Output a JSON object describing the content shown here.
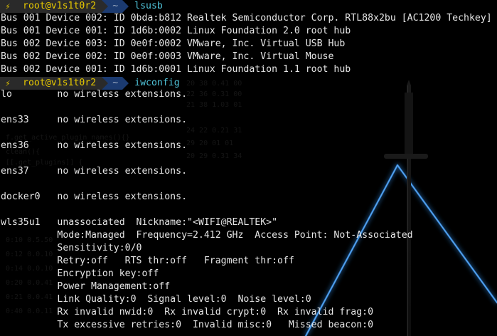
{
  "prompt": {
    "bolt_icon": "lightning-icon",
    "user_host": "root@v1s1t0r2",
    "directory": "~"
  },
  "lsusb": {
    "command": "lsusb",
    "lines": [
      "Bus 001 Device 002: ID 0bda:b812 Realtek Semiconductor Corp. RTL88x2bu [AC1200 Techkey]",
      "Bus 001 Device 001: ID 1d6b:0002 Linux Foundation 2.0 root hub",
      "Bus 002 Device 003: ID 0e0f:0002 VMware, Inc. Virtual USB Hub",
      "Bus 002 Device 002: ID 0e0f:0003 VMware, Inc. Virtual Mouse",
      "Bus 002 Device 001: ID 1d6b:0001 Linux Foundation 1.1 root hub"
    ]
  },
  "iwconfig": {
    "command": "iwconfig",
    "lines": [
      "lo        no wireless extensions.",
      "",
      "ens33     no wireless extensions.",
      "",
      "ens36     no wireless extensions.",
      "",
      "ens37     no wireless extensions.",
      "",
      "docker0   no wireless extensions.",
      "",
      "wls35u1   unassociated  Nickname:\"<WIFI@REALTEK>\"",
      "          Mode:Managed  Frequency=2.412 GHz  Access Point: Not-Associated",
      "          Sensitivity:0/0",
      "          Retry:off   RTS thr:off   Fragment thr:off",
      "          Encryption key:off",
      "          Power Management:off",
      "          Link Quality:0  Signal level:0  Noise level:0",
      "          Rx invalid nwid:0  Rx invalid crypt:0  Rx invalid frag:0",
      "          Tx excessive retries:0  Invalid misc:0   Missed beacon:0"
    ]
  },
  "colors": {
    "background": "#000000",
    "text": "#e6e6e6",
    "prompt_user_bg": "#2a2a2a",
    "prompt_user_fg": "#e6c800",
    "prompt_dir_bg": "#1b3a70",
    "command": "#4fc3d9",
    "glow": "#2f7fd0"
  }
}
